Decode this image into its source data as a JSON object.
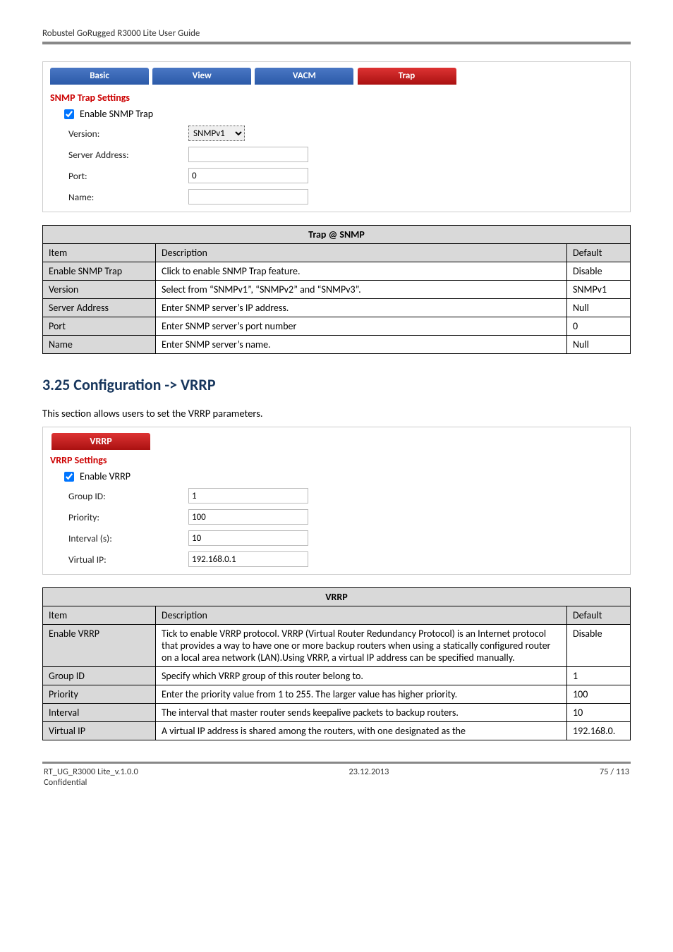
{
  "header_text": "Robustel GoRugged R3000 Lite User Guide",
  "snmp_panel": {
    "tabs": [
      "Basic",
      "View",
      "VACM",
      "Trap"
    ],
    "heading": "SNMP Trap Settings",
    "enable_label": "Enable SNMP Trap",
    "rows": [
      {
        "label": "Version:",
        "kind": "select",
        "value": "SNMPv1"
      },
      {
        "label": "Server Address:",
        "kind": "text",
        "value": ""
      },
      {
        "label": "Port:",
        "kind": "text",
        "value": "0"
      },
      {
        "label": "Name:",
        "kind": "text",
        "value": ""
      }
    ]
  },
  "snmp_table": {
    "title": "Trap @ SNMP",
    "item_hdr": "Item",
    "desc_hdr": "Description",
    "def_hdr": "Default",
    "rows": [
      {
        "item": "Enable SNMP Trap",
        "desc": "Click to enable SNMP Trap feature.",
        "def": "Disable"
      },
      {
        "item": "Version",
        "desc": "Select from “SNMPv1”, “SNMPv2” and “SNMPv3”.",
        "def": "SNMPv1"
      },
      {
        "item": "Server Address",
        "desc": "Enter SNMP server’s IP address.",
        "def": "Null"
      },
      {
        "item": "Port",
        "desc": "Enter SNMP server’s port number",
        "def": "0"
      },
      {
        "item": "Name",
        "desc": "Enter SNMP server’s name.",
        "def": "Null"
      }
    ]
  },
  "section_heading": "3.25  Configuration -> VRRP",
  "section_intro": "This section allows users to set the VRRP parameters.",
  "vrrp_panel": {
    "tab": "VRRP",
    "heading": "VRRP Settings",
    "enable_label": "Enable VRRP",
    "rows": [
      {
        "label": "Group ID:",
        "value": "1"
      },
      {
        "label": "Priority:",
        "value": "100"
      },
      {
        "label": "Interval (s):",
        "value": "10"
      },
      {
        "label": "Virtual IP:",
        "value": "192.168.0.1"
      }
    ]
  },
  "vrrp_table": {
    "title": "VRRP",
    "item_hdr": "Item",
    "desc_hdr": "Description",
    "def_hdr": "Default",
    "rows": [
      {
        "item": "Enable VRRP",
        "desc": "Tick to enable VRRP protocol. VRRP (Virtual Router Redundancy Protocol) is an Internet protocol that provides a way to have one or more backup routers when using a statically configured router on a local area network (LAN).Using VRRP, a virtual IP address can be specified manually.",
        "def": "Disable"
      },
      {
        "item": "Group ID",
        "desc": "Specify which VRRP group of this router belong to.",
        "def": "1"
      },
      {
        "item": "Priority",
        "desc": "Enter the priority value from 1 to 255. The larger value has higher priority.",
        "def": "100"
      },
      {
        "item": "Interval",
        "desc": "The interval that master router sends keepalive packets to backup routers.",
        "def": "10"
      },
      {
        "item": "Virtual IP",
        "desc": "A virtual IP address is shared among the routers, with one designated as the",
        "def": "192.168.0."
      }
    ]
  },
  "footer": {
    "left": "RT_UG_R3000 Lite_v.1.0.0",
    "left2": "Confidential",
    "center": "23.12.2013",
    "right": "75 / 113"
  }
}
